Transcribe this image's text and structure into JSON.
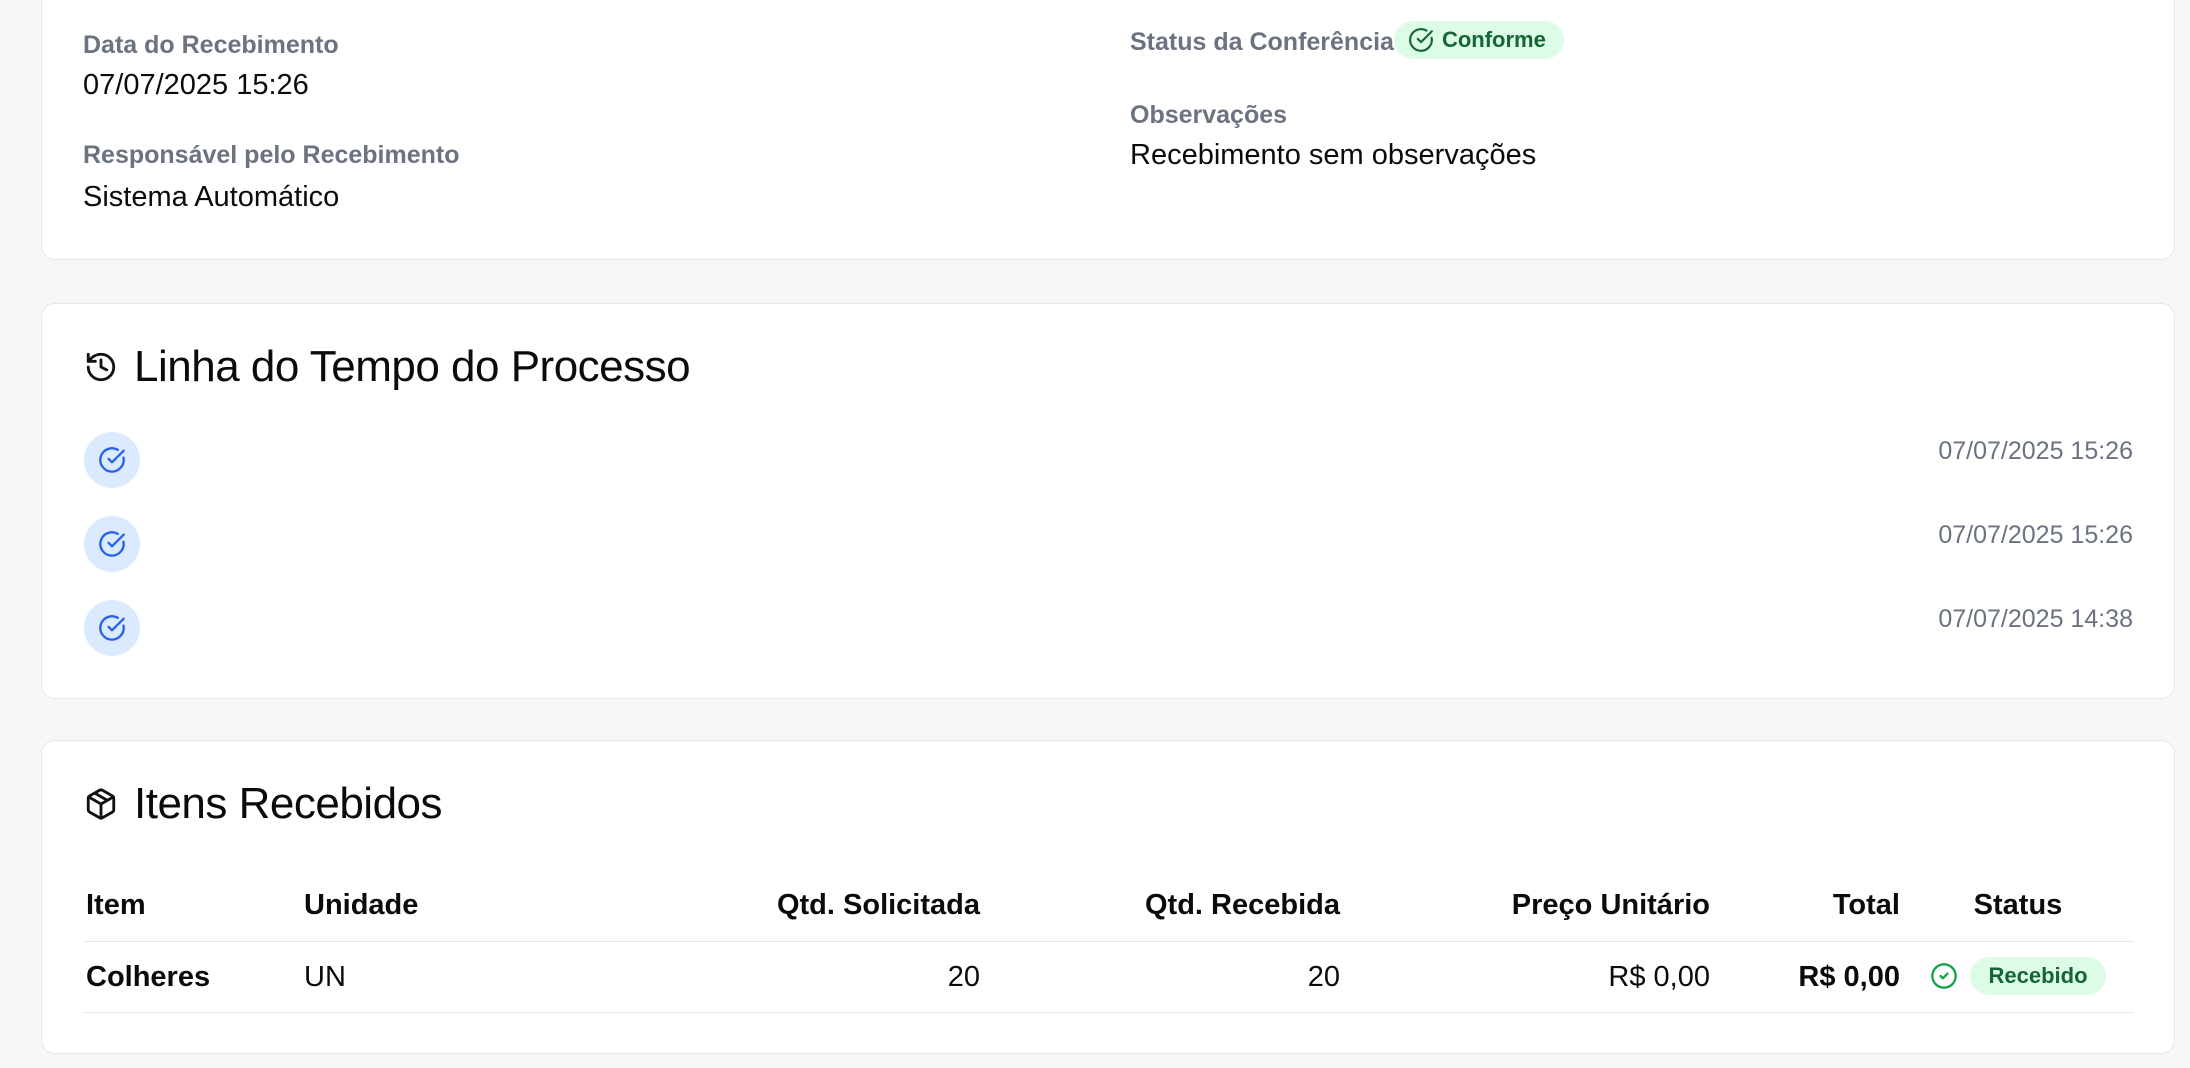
{
  "receipt": {
    "date_label": "Data do Recebimento",
    "date_value": "07/07/2025 15:26",
    "responsible_label": "Responsável pelo Recebimento",
    "responsible_value": "Sistema Automático",
    "status_label": "Status da Conferência",
    "status_value": "Conforme",
    "notes_label": "Observações",
    "notes_value": "Recebimento sem observações"
  },
  "timeline": {
    "title": "Linha do Tempo do Processo",
    "icon": "history-icon",
    "events": [
      {
        "icon": "check-circle-icon",
        "date": "07/07/2025 15:26"
      },
      {
        "icon": "check-circle-icon",
        "date": "07/07/2025 15:26"
      },
      {
        "icon": "check-circle-icon",
        "date": "07/07/2025 14:38"
      }
    ]
  },
  "items": {
    "title": "Itens Recebidos",
    "icon": "package-icon",
    "columns": [
      "Item",
      "Unidade",
      "Qtd. Solicitada",
      "Qtd. Recebida",
      "Preço Unitário",
      "Total",
      "Status"
    ],
    "rows": [
      {
        "item": "Colheres",
        "unit": "UN",
        "qty_requested": "20",
        "qty_received": "20",
        "unit_price": "R$ 0,00",
        "total": "R$ 0,00",
        "status": "Recebido"
      }
    ]
  },
  "colors": {
    "success_bg": "#dcfce7",
    "success_text": "#166534",
    "timeline_icon_bg": "#dbeafe",
    "timeline_icon": "#2563eb"
  }
}
